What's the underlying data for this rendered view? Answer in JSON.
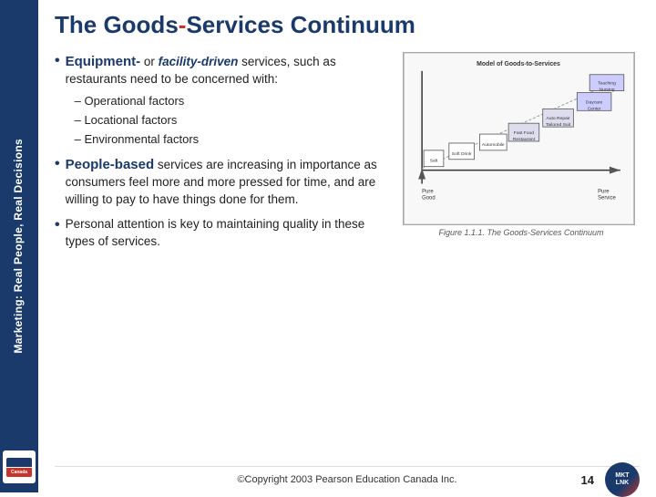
{
  "sidebar": {
    "label": "Marketing: Real People, Real Decisions",
    "logo_top": "Pearson",
    "logo_bottom": "Education Canada"
  },
  "header": {
    "title_part1": "The Goods",
    "title_dash": "-",
    "title_part2": "Services Continuum"
  },
  "bullet1": {
    "label": "Equipment-",
    "label2": " or ",
    "label3": "facility-driven",
    "text": " services, such as restaurants need to be concerned with:",
    "subitems": [
      "Operational factors",
      "Locational factors",
      "Environmental factors"
    ]
  },
  "bullet2": {
    "label": "People-based",
    "text": " services are increasing in importance as consumers feel more and more pressed for time, and are willing to pay to have things done for them."
  },
  "bullet3": {
    "text": "Personal attention is key to maintaining quality in these types of services."
  },
  "diagram": {
    "caption": "Figure 1.1.1. The Goods-Services Continuum"
  },
  "footer": {
    "copyright": "©Copyright 2003 Pearson Education Canada Inc.",
    "page_number": "14"
  }
}
